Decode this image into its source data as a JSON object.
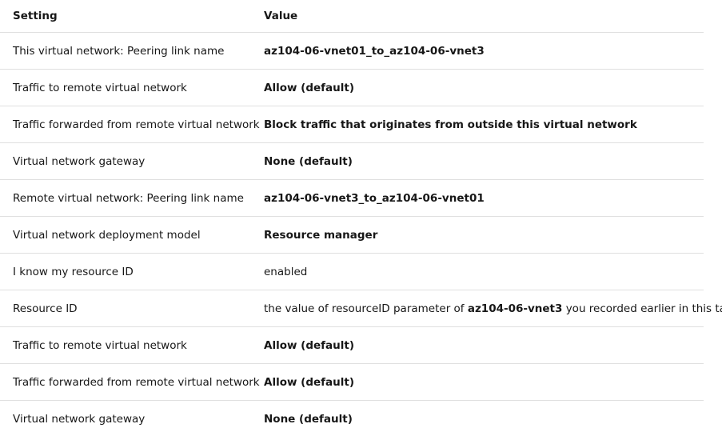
{
  "table": {
    "headers": {
      "setting": "Setting",
      "value": "Value"
    },
    "rows": [
      {
        "setting": "This virtual network: Peering link name",
        "value": "az104-06-vnet01_to_az104-06-vnet3"
      },
      {
        "setting": "Traffic to remote virtual network",
        "value": "Allow (default)"
      },
      {
        "setting": "Traffic forwarded from remote virtual network",
        "value": "Block traffic that originates from outside this virtual network"
      },
      {
        "setting": "Virtual network gateway",
        "value": "None (default)"
      },
      {
        "setting": "Remote virtual network: Peering link name",
        "value": "az104-06-vnet3_to_az104-06-vnet01"
      },
      {
        "setting": "Virtual network deployment model",
        "value": "Resource manager"
      },
      {
        "setting": "I know my resource ID",
        "value": "enabled"
      },
      {
        "setting": "Resource ID",
        "value_pre": "the value of resourceID parameter of ",
        "value_bold": "az104-06-vnet3",
        "value_post": " you recorded earlier in this task"
      },
      {
        "setting": "Traffic to remote virtual network",
        "value": "Allow (default)"
      },
      {
        "setting": "Traffic forwarded from remote virtual network",
        "value": "Allow (default)"
      },
      {
        "setting": "Virtual network gateway",
        "value": "None (default)"
      }
    ]
  }
}
